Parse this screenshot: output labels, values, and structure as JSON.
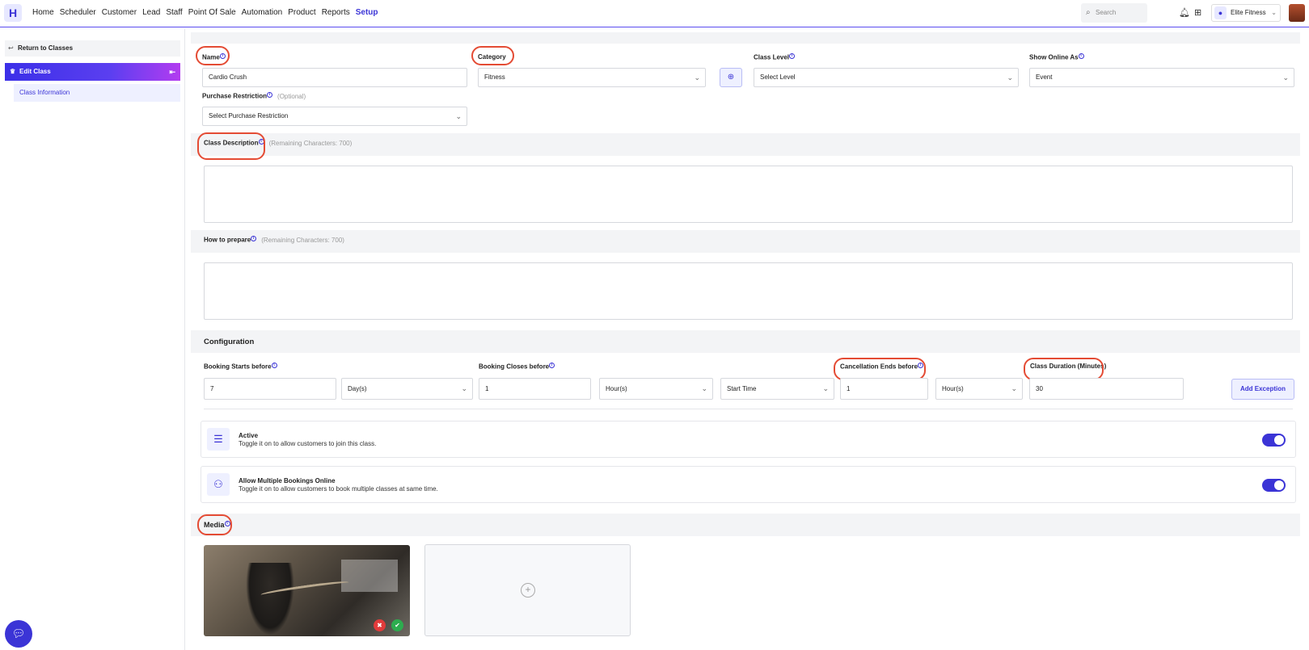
{
  "header": {
    "logo": "H",
    "nav": [
      "Home",
      "Scheduler",
      "Customer",
      "Lead",
      "Staff",
      "Point Of Sale",
      "Automation",
      "Product",
      "Reports",
      "Setup"
    ],
    "search_placeholder": "Search",
    "location": "Elite Fitness"
  },
  "sidebar": {
    "return_label": "Return to Classes",
    "edit_label": "Edit Class",
    "item_label": "Class Information"
  },
  "form": {
    "name_label": "Name",
    "name_value": "Cardio Crush",
    "category_label": "Category",
    "category_value": "Fitness",
    "class_level_label": "Class Level",
    "class_level_value": "Select Level",
    "show_online_label": "Show Online As",
    "show_online_value": "Event",
    "purchase_label": "Purchase Restriction",
    "purchase_optional": "(Optional)",
    "purchase_value": "Select Purchase Restriction",
    "description_label": "Class Description",
    "description_remaining": "(Remaining Characters: 700)",
    "prepare_label": "How to prepare",
    "prepare_remaining": "(Remaining Characters: 700)"
  },
  "configuration": {
    "title": "Configuration",
    "booking_starts_label": "Booking Starts before",
    "booking_starts_value": "7",
    "booking_starts_unit": "Day(s)",
    "booking_closes_label": "Booking Closes before",
    "booking_closes_value": "1",
    "booking_closes_unit": "Hour(s)",
    "booking_closes_ref": "Start Time",
    "cancellation_label": "Cancellation Ends before",
    "cancellation_value": "1",
    "cancellation_unit": "Hour(s)",
    "duration_label": "Class Duration (Minutes)",
    "duration_value": "30",
    "add_exception": "Add Exception"
  },
  "toggles": [
    {
      "title": "Active",
      "subtitle": "Toggle it on to allow customers to join this class.",
      "on": true
    },
    {
      "title": "Allow Multiple Bookings Online",
      "subtitle": "Toggle it on to allow customers to book multiple classes at same time.",
      "on": true
    }
  ],
  "media": {
    "title": "Media"
  },
  "colors": {
    "accent": "#3b34d6",
    "highlight": "#e44b34"
  }
}
